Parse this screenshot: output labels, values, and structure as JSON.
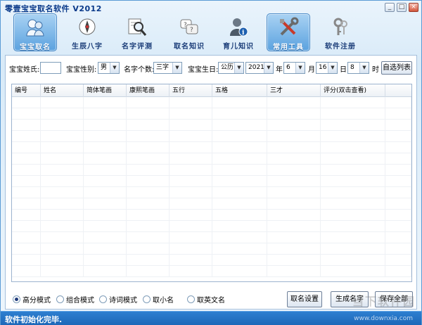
{
  "window": {
    "title": "零壹宝宝取名软件 V2012",
    "minimize": "_",
    "maximize": "□",
    "close": "×"
  },
  "nav": [
    {
      "label": "宝宝取名",
      "icon": "babies-icon",
      "active": true
    },
    {
      "label": "生辰八字",
      "icon": "compass-icon",
      "active": false
    },
    {
      "label": "名字评测",
      "icon": "magnifier-icon",
      "active": false
    },
    {
      "label": "取名知识",
      "icon": "question-bubbles-icon",
      "active": false
    },
    {
      "label": "育儿知识",
      "icon": "info-person-icon",
      "active": false
    },
    {
      "label": "常用工具",
      "icon": "tools-icon",
      "active": false
    },
    {
      "label": "软件注册",
      "icon": "keys-icon",
      "active": false
    }
  ],
  "form": {
    "surname_label": "宝宝姓氏:",
    "surname_value": "",
    "gender_label": "宝宝性别:",
    "gender_value": "男",
    "count_label": "名字个数:",
    "count_value": "三字",
    "birth_label": "宝宝生日:",
    "calendar_value": "公历",
    "year_value": "2021",
    "year_label": "年",
    "month_value": "6",
    "month_label": "月",
    "day_value": "16",
    "day_label": "日",
    "hour_value": "8",
    "hour_label": "时",
    "custom_list_button": "自选列表"
  },
  "table": {
    "columns": [
      "编号",
      "姓名",
      "简体笔画",
      "康熙笔画",
      "五行",
      "五格",
      "三才",
      "评分(双击查看)"
    ],
    "rows": []
  },
  "modes": [
    {
      "label": "高分模式",
      "selected": true
    },
    {
      "label": "组合模式",
      "selected": false
    },
    {
      "label": "诗词模式",
      "selected": false
    },
    {
      "label": "取小名",
      "selected": false
    },
    {
      "label": "取英文名",
      "selected": false
    }
  ],
  "buttons": {
    "settings": "取名设置",
    "generate": "生成名字",
    "save": "保存全部"
  },
  "status": {
    "text": "软件初始化完毕."
  },
  "watermark": {
    "text": "当下软件园",
    "subtext": "www.downxia.com"
  }
}
